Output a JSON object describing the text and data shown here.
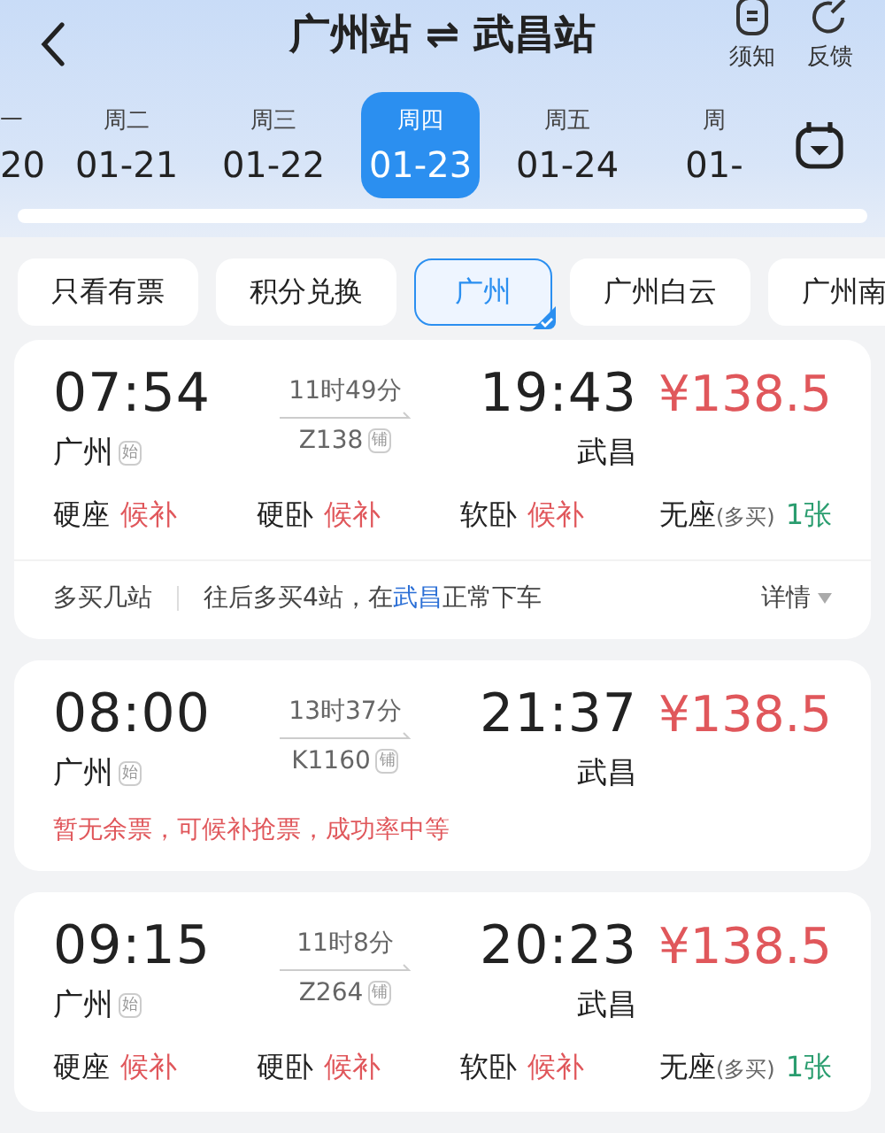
{
  "header": {
    "title_from": "广州站",
    "swap_symbol": "⇌",
    "title_to": "武昌站",
    "actions": [
      {
        "kind": "notice",
        "label": "须知"
      },
      {
        "kind": "feedback",
        "label": "反馈"
      }
    ]
  },
  "dates": [
    {
      "weekday": "一",
      "date": "20",
      "selected": false
    },
    {
      "weekday": "周二",
      "date": "01-21",
      "selected": false
    },
    {
      "weekday": "周三",
      "date": "01-22",
      "selected": false
    },
    {
      "weekday": "周四",
      "date": "01-23",
      "selected": true
    },
    {
      "weekday": "周五",
      "date": "01-24",
      "selected": false
    },
    {
      "weekday": "周",
      "date": "01-",
      "selected": false
    }
  ],
  "filters": [
    {
      "label": "只看有票",
      "selected": false
    },
    {
      "label": "积分兑换",
      "selected": false
    },
    {
      "label": "广州",
      "selected": true
    },
    {
      "label": "广州白云",
      "selected": false
    },
    {
      "label": "广州南",
      "selected": false
    }
  ],
  "trains": [
    {
      "depart": "07:54",
      "from": "广州",
      "from_tag": "始",
      "duration": "11时49分",
      "train_no": "Z138",
      "train_tag": "铺",
      "arrive": "19:43",
      "to": "武昌",
      "price": "¥138.5",
      "seats": [
        {
          "name": "硬座",
          "status": "候补",
          "kind": "waitlist"
        },
        {
          "name": "硬卧",
          "status": "候补",
          "kind": "waitlist"
        },
        {
          "name": "软卧",
          "status": "候补",
          "kind": "waitlist"
        },
        {
          "name": "无座",
          "note": "(多买)",
          "status": "1张",
          "kind": "available"
        }
      ],
      "footer": {
        "label": "多买几站",
        "before": "往后多买4站，在",
        "link": "武昌",
        "after": "正常下车",
        "action": "详情"
      }
    },
    {
      "depart": "08:00",
      "from": "广州",
      "from_tag": "始",
      "duration": "13时37分",
      "train_no": "K1160",
      "train_tag": "铺",
      "arrive": "21:37",
      "to": "武昌",
      "price": "¥138.5",
      "notice": "暂无余票，可候补抢票，成功率中等"
    },
    {
      "depart": "09:15",
      "from": "广州",
      "from_tag": "始",
      "duration": "11时8分",
      "train_no": "Z264",
      "train_tag": "铺",
      "arrive": "20:23",
      "to": "武昌",
      "price": "¥138.5",
      "seats": [
        {
          "name": "硬座",
          "status": "候补",
          "kind": "waitlist"
        },
        {
          "name": "硬卧",
          "status": "候补",
          "kind": "waitlist"
        },
        {
          "name": "软卧",
          "status": "候补",
          "kind": "waitlist"
        },
        {
          "name": "无座",
          "note": "(多买)",
          "status": "1张",
          "kind": "available"
        }
      ]
    }
  ]
}
